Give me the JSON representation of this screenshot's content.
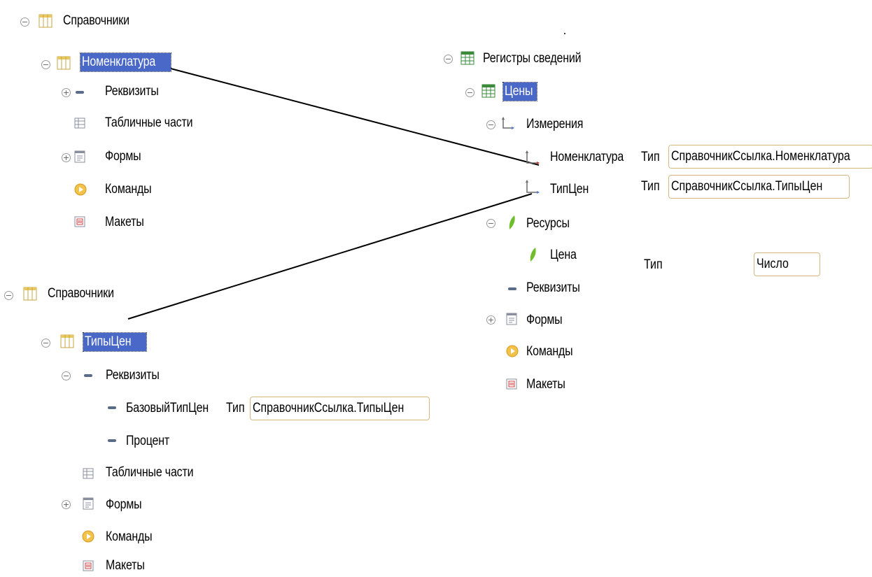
{
  "top_left_tree": {
    "root": "Справочники",
    "catalog": "Номенклатура",
    "children": [
      "Реквизиты",
      "Табличные части",
      "Формы",
      "Команды",
      "Макеты"
    ]
  },
  "right_tree": {
    "root": "Регистры сведений",
    "register": "Цены",
    "dimensions": "Измерения",
    "dim_1": "Номенклатура",
    "dim_2": "ТипЦен",
    "resources": "Ресурсы",
    "resource_1": "Цена",
    "attributes": "Реквизиты",
    "forms": "Формы",
    "commands": "Команды",
    "layouts": "Макеты",
    "type_label": "Тип",
    "dim_1_type": "СправочникСсылка.Номенклатура",
    "dim_2_type": "СправочникСсылка.ТипыЦен",
    "resource_1_type": "Число"
  },
  "bottom_left_tree": {
    "root": "Справочники",
    "catalog": "ТипыЦен",
    "attributes": "Реквизиты",
    "attr_1": "БазовыйТипЦен",
    "attr_2": "Процент",
    "type_label": "Тип",
    "attr_1_type": "СправочникСсылка.ТипыЦен",
    "tabular": "Табличные части",
    "forms": "Формы",
    "commands": "Команды",
    "layouts": "Макеты"
  }
}
